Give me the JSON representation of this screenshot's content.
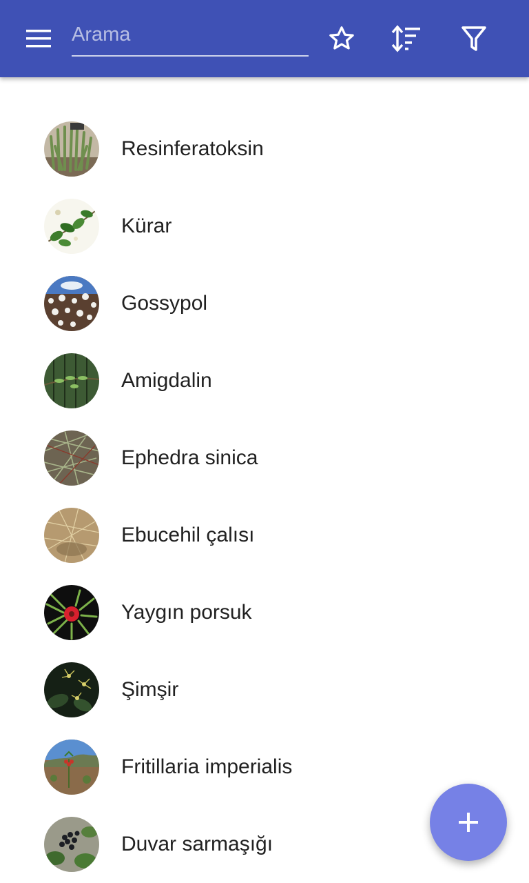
{
  "toolbar": {
    "search_placeholder": "Arama",
    "search_value": "",
    "color": "#3f51b5",
    "icons": [
      "menu-icon",
      "star-icon",
      "sort-icon",
      "filter-icon"
    ]
  },
  "plants": [
    {
      "name": "Resinferatoksin",
      "thumb": "resin-spurge-photo"
    },
    {
      "name": "Kürar",
      "thumb": "curare-vine-illustration"
    },
    {
      "name": "Gossypol",
      "thumb": "cotton-field-photo"
    },
    {
      "name": "Amigdalin",
      "thumb": "almond-branch-photo"
    },
    {
      "name": "Ephedra sinica",
      "thumb": "ephedra-stems-photo"
    },
    {
      "name": "Ebucehil çalısı",
      "thumb": "dry-shrub-photo"
    },
    {
      "name": "Yaygın porsuk",
      "thumb": "yew-berry-photo"
    },
    {
      "name": "Şimşir",
      "thumb": "boxwood-flowers-photo"
    },
    {
      "name": "Fritillaria imperialis",
      "thumb": "crown-imperial-photo"
    },
    {
      "name": "Duvar sarmaşığı",
      "thumb": "ivy-berries-photo"
    }
  ],
  "fab": {
    "icon": "plus-icon",
    "color": "#7681e6"
  }
}
